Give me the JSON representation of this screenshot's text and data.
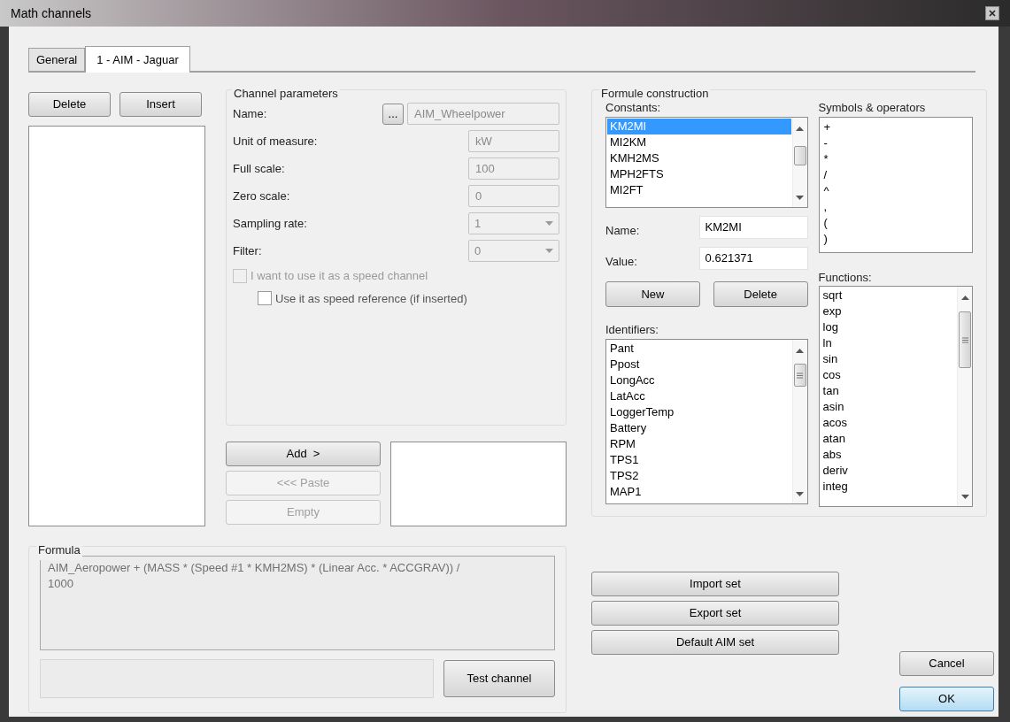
{
  "window": {
    "title": "Math channels"
  },
  "tabs": [
    {
      "label": "General",
      "selected": false
    },
    {
      "label": "1 - AIM - Jaguar",
      "selected": true
    }
  ],
  "channel_list": {
    "buttons": [
      "Delete",
      "Insert"
    ]
  },
  "channel_parameters": {
    "title": "Channel parameters",
    "fields": [
      {
        "label": "Name:",
        "value": "AIM_Wheelpower",
        "kind": "browse",
        "button": "..."
      },
      {
        "label": "Unit of measure:",
        "value": "kW",
        "kind": "text"
      },
      {
        "label": "Full scale:",
        "value": "100",
        "kind": "text"
      },
      {
        "label": "Zero scale:",
        "value": "0",
        "kind": "text"
      },
      {
        "label": "Sampling rate:",
        "value": "1",
        "kind": "select"
      },
      {
        "label": "Filter:",
        "value": "0",
        "kind": "select"
      }
    ],
    "checkboxes": [
      {
        "label": "I want to use it as a speed channel",
        "checked": false,
        "disabled": true,
        "nested": false
      },
      {
        "label": "Use it as speed reference (if inserted)",
        "checked": false,
        "disabled": false,
        "nested": true
      }
    ]
  },
  "formula_buttons": [
    {
      "label": "Add  >",
      "disabled": false
    },
    {
      "label": "<<< Paste",
      "disabled": true
    },
    {
      "label": "Empty",
      "disabled": true
    }
  ],
  "formula": {
    "title": "Formula",
    "text": "AIM_Aeropower + (MASS * (Speed #1 * KMH2MS) * (Linear Acc. * ACCGRAV)) / 1000",
    "test_button": "Test channel"
  },
  "formule_construction": {
    "title": "Formule construction",
    "constants": {
      "label": "Constants:",
      "items": [
        {
          "text": "KM2MI",
          "selected": true
        },
        {
          "text": "MI2KM",
          "selected": false
        },
        {
          "text": "KMH2MS",
          "selected": false
        },
        {
          "text": "MPH2FTS",
          "selected": false
        },
        {
          "text": "MI2FT",
          "selected": false
        }
      ]
    },
    "name": {
      "label": "Name:",
      "value": "KM2MI"
    },
    "value": {
      "label": "Value:",
      "value": "0.621371"
    },
    "buttons": [
      "New",
      "Delete"
    ],
    "identifiers": {
      "label": "Identifiers:",
      "items": [
        "Pant",
        "Ppost",
        "LongAcc",
        "LatAcc",
        "LoggerTemp",
        "Battery",
        "RPM",
        "TPS1",
        "TPS2",
        "MAP1"
      ]
    },
    "symbols": {
      "label": "Symbols & operators",
      "items": [
        "+",
        "-",
        "*",
        "/",
        "^",
        ",",
        "(",
        ")"
      ]
    },
    "functions": {
      "label": "Functions:",
      "items": [
        "sqrt",
        "exp",
        "log",
        "ln",
        "sin",
        "cos",
        "tan",
        "asin",
        "acos",
        "atan",
        "abs",
        "deriv",
        "integ"
      ]
    }
  },
  "set_buttons": [
    "Import set",
    "Export set",
    "Default AIM set"
  ],
  "dialog_buttons": [
    {
      "label": "Cancel",
      "default": false
    },
    {
      "label": "OK",
      "default": true
    }
  ]
}
